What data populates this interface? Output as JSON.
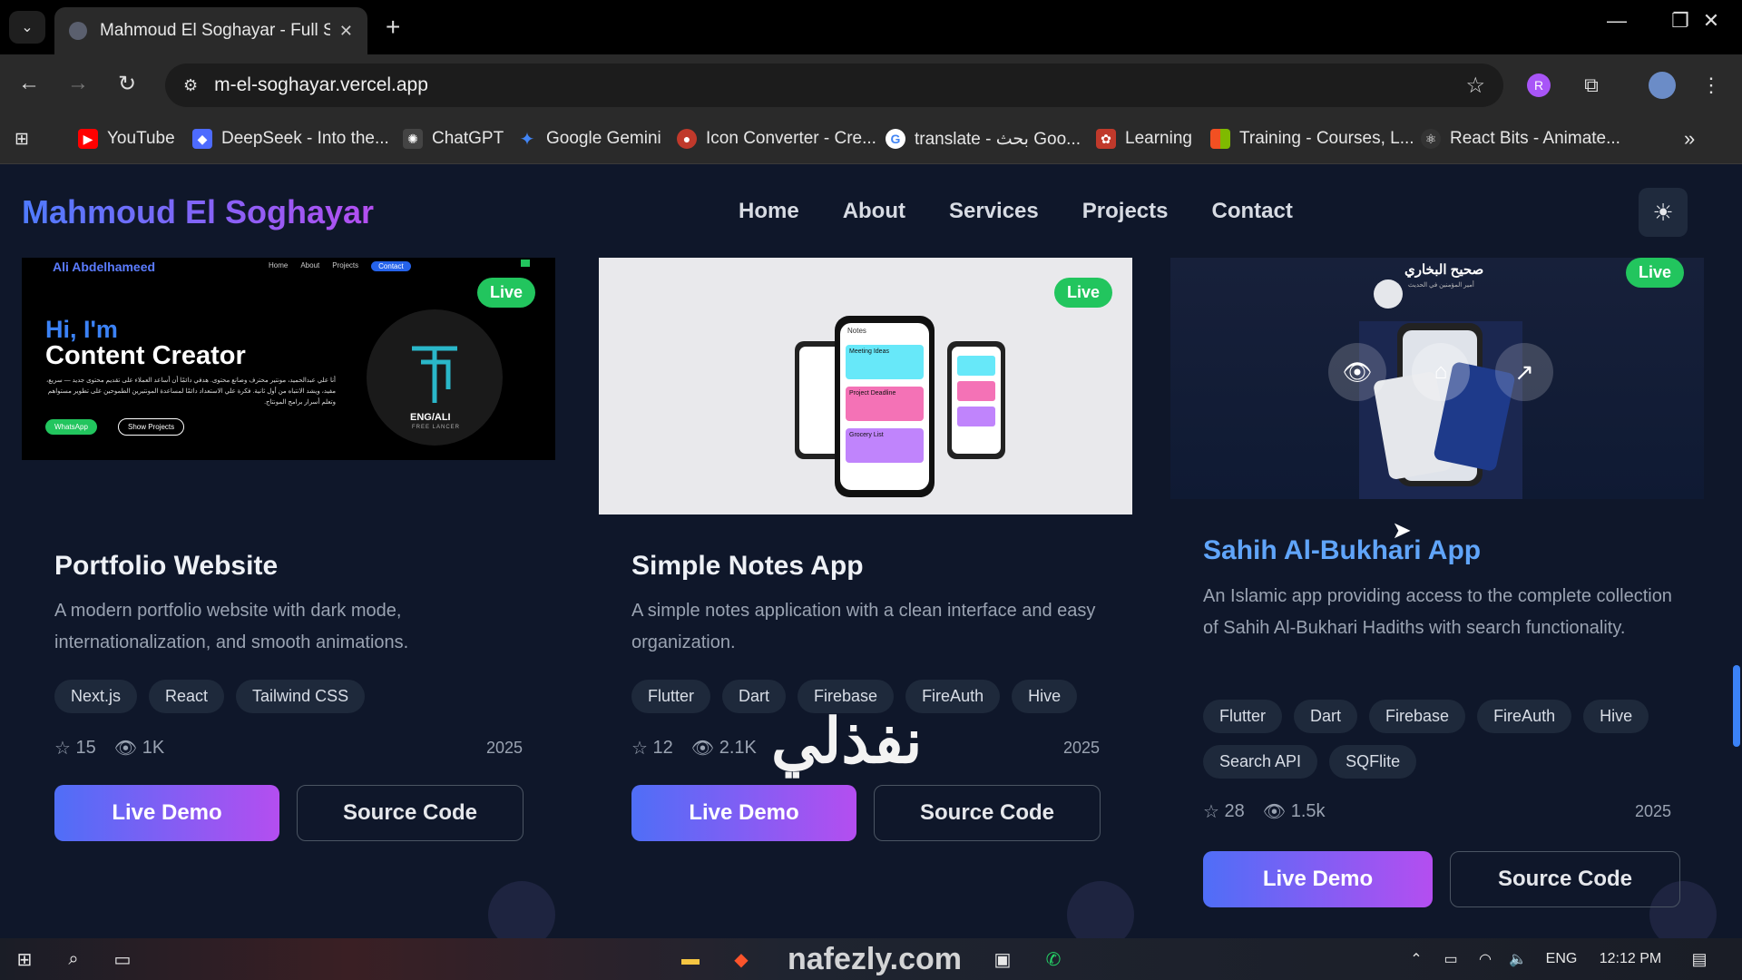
{
  "browser": {
    "tab_title": "Mahmoud El Soghayar - Full St",
    "url": "m-el-soghayar.vercel.app",
    "bookmarks": [
      {
        "label": "YouTube",
        "icon": "youtube-icon",
        "color": "#ff0000"
      },
      {
        "label": "DeepSeek - Into the...",
        "icon": "deepseek-icon",
        "color": "#4d6bfe"
      },
      {
        "label": "ChatGPT",
        "icon": "chatgpt-icon",
        "color": "#444444"
      },
      {
        "label": "Google Gemini",
        "icon": "gemini-icon",
        "color": "#4285f4"
      },
      {
        "label": "Icon Converter - Cre...",
        "icon": "icon-converter-icon",
        "color": "#c0392b"
      },
      {
        "label": "translate - بحث Goo...",
        "icon": "google-icon",
        "color": "#ffffff"
      },
      {
        "label": "Learning",
        "icon": "learning-icon",
        "color": "#c0392b"
      },
      {
        "label": "Training - Courses, L...",
        "icon": "microsoft-icon",
        "color": "#f25022"
      },
      {
        "label": "React Bits - Animate...",
        "icon": "react-bits-icon",
        "color": "#333333"
      }
    ]
  },
  "site": {
    "brand": "Mahmoud El Soghayar",
    "nav": [
      "Home",
      "About",
      "Services",
      "Projects",
      "Contact"
    ]
  },
  "projects": [
    {
      "badge": "Live",
      "title": "Portfolio Website",
      "description": "A modern portfolio website with dark mode, internationalization, and smooth animations.",
      "tags": [
        "Next.js",
        "React",
        "Tailwind CSS"
      ],
      "stars": "15",
      "views": "1K",
      "year": "2025",
      "live_label": "Live Demo",
      "source_label": "Source Code",
      "thumb": {
        "name": "Ali Abdelhameed",
        "nav": [
          "Home",
          "About",
          "Projects",
          "Contact"
        ],
        "hi": "Hi, I'm",
        "role": "Content Creator",
        "text": "أنا علي عبدالحميد، مونتير محترف وصانع محتوى. هدفي دائمًا أن أساعد العملاء على تقديم محتوى جديد — سريع، مفيد، ويشد الانتباه من أول ثانية. فكرة علي الاستعداد دائمًا لمساعدة المونتيرين الطموحين على تطوير مستواهم وتعلم أسرار برامج المونتاج.",
        "btn1": "WhatsApp",
        "btn2": "Show Projects",
        "logo": "ENG/ALI",
        "logo_sub": "FREE LANCER"
      }
    },
    {
      "badge": "Live",
      "title": "Simple Notes App",
      "description": "A simple notes application with a clean interface and easy organization.",
      "tags": [
        "Flutter",
        "Dart",
        "Firebase",
        "FireAuth",
        "Hive"
      ],
      "stars": "12",
      "views": "2.1K",
      "year": "2025",
      "live_label": "Live Demo",
      "source_label": "Source Code",
      "thumb": {
        "header": "Notes",
        "notes": [
          "Meeting Ideas",
          "Project Deadline",
          "Grocery List"
        ],
        "note_colors": [
          "#67e8f9",
          "#f472b6",
          "#c084fc"
        ]
      }
    },
    {
      "badge": "Live",
      "title": "Sahih Al-Bukhari App",
      "description": "An Islamic app providing access to the complete collection of Sahih Al-Bukhari Hadiths with search functionality.",
      "tags": [
        "Flutter",
        "Dart",
        "Firebase",
        "FireAuth",
        "Hive",
        "Search API",
        "SQFlite"
      ],
      "stars": "28",
      "views": "1.5k",
      "year": "2025",
      "live_label": "Live Demo",
      "source_label": "Source Code",
      "thumb": {
        "heading": "صحيح البخاري",
        "sub": "أمير المؤمنين في الحديث"
      }
    }
  ],
  "watermark": "نفذلي",
  "taskbar": {
    "lang": "ENG",
    "time": "12:12 PM",
    "watermark_url": "nafezly.com"
  },
  "colors": {
    "accent_start": "#4f6ef7",
    "accent_end": "#b44ef0",
    "live_badge": "#22c55e",
    "page_bg": "#0f172a",
    "hover_title": "#60a5fa"
  }
}
